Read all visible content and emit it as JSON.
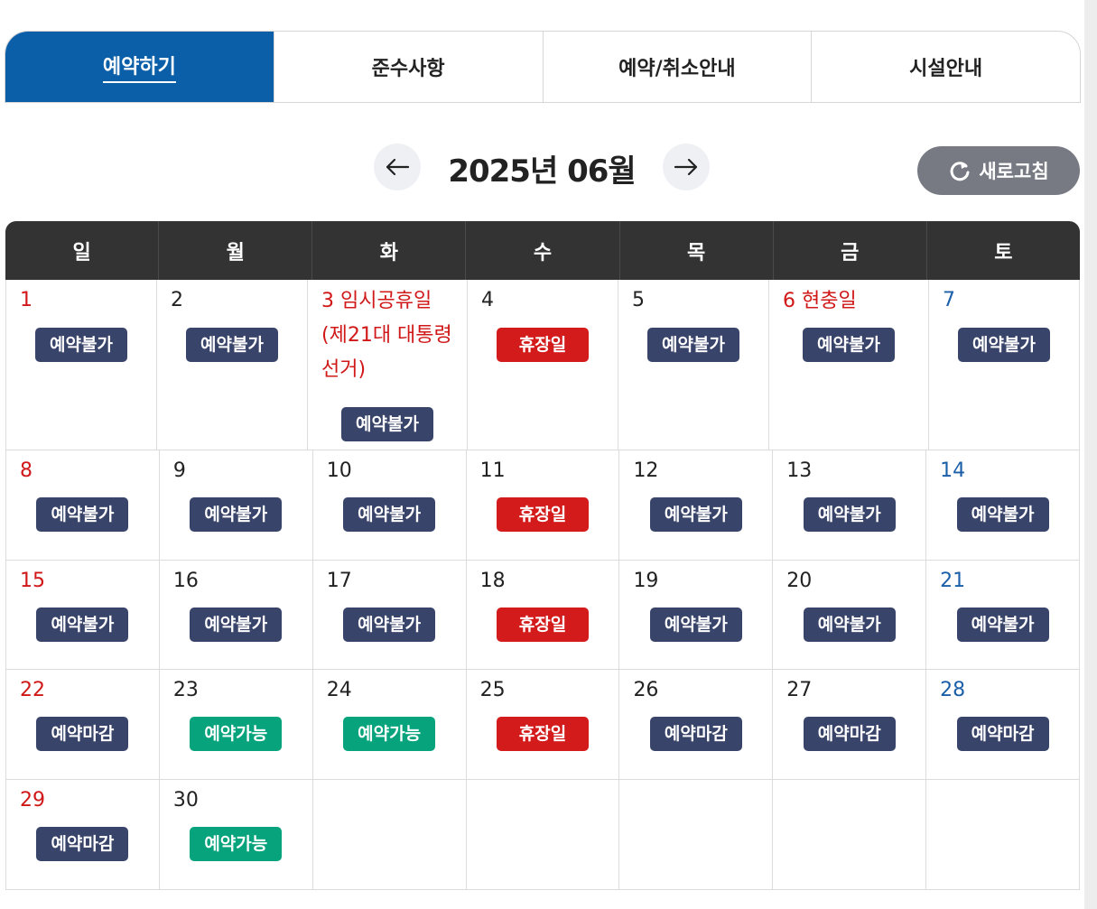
{
  "tabs": [
    {
      "label": "예약하기",
      "active": true
    },
    {
      "label": "준수사항",
      "active": false
    },
    {
      "label": "예약/취소안내",
      "active": false
    },
    {
      "label": "시설안내",
      "active": false
    }
  ],
  "month_nav": {
    "title": "2025년 06월",
    "prev_icon": "arrow-left-icon",
    "next_icon": "arrow-right-icon"
  },
  "refresh": {
    "label": "새로고침",
    "icon": "refresh-icon"
  },
  "weekdays": [
    "일",
    "월",
    "화",
    "수",
    "목",
    "금",
    "토"
  ],
  "colors": {
    "active_tab": "#0b5ea8",
    "unavailable": "#39446a",
    "closed": "#d41b1b",
    "available": "#06a37c",
    "sunday": "#d01818",
    "saturday": "#1b5fa8"
  },
  "weeks": [
    [
      {
        "day": "1",
        "status": "예약불가"
      },
      {
        "day": "2",
        "status": "예약불가"
      },
      {
        "day": "3",
        "holiday": "임시공휴일 (제21대 대통령 선거)",
        "status": "예약불가"
      },
      {
        "day": "4",
        "status": "휴장일"
      },
      {
        "day": "5",
        "status": "예약불가"
      },
      {
        "day": "6",
        "holiday": "현충일",
        "status": "예약불가"
      },
      {
        "day": "7",
        "status": "예약불가"
      }
    ],
    [
      {
        "day": "8",
        "status": "예약불가"
      },
      {
        "day": "9",
        "status": "예약불가"
      },
      {
        "day": "10",
        "status": "예약불가"
      },
      {
        "day": "11",
        "status": "휴장일"
      },
      {
        "day": "12",
        "status": "예약불가"
      },
      {
        "day": "13",
        "status": "예약불가"
      },
      {
        "day": "14",
        "status": "예약불가"
      }
    ],
    [
      {
        "day": "15",
        "status": "예약불가"
      },
      {
        "day": "16",
        "status": "예약불가"
      },
      {
        "day": "17",
        "status": "예약불가"
      },
      {
        "day": "18",
        "status": "휴장일"
      },
      {
        "day": "19",
        "status": "예약불가"
      },
      {
        "day": "20",
        "status": "예약불가"
      },
      {
        "day": "21",
        "status": "예약불가"
      }
    ],
    [
      {
        "day": "22",
        "status": "예약마감"
      },
      {
        "day": "23",
        "status": "예약가능"
      },
      {
        "day": "24",
        "status": "예약가능"
      },
      {
        "day": "25",
        "status": "휴장일"
      },
      {
        "day": "26",
        "status": "예약마감"
      },
      {
        "day": "27",
        "status": "예약마감"
      },
      {
        "day": "28",
        "status": "예약마감"
      }
    ],
    [
      {
        "day": "29",
        "status": "예약마감"
      },
      {
        "day": "30",
        "status": "예약가능"
      },
      {
        "day": "",
        "status": ""
      },
      {
        "day": "",
        "status": ""
      },
      {
        "day": "",
        "status": ""
      },
      {
        "day": "",
        "status": ""
      },
      {
        "day": "",
        "status": ""
      }
    ]
  ]
}
